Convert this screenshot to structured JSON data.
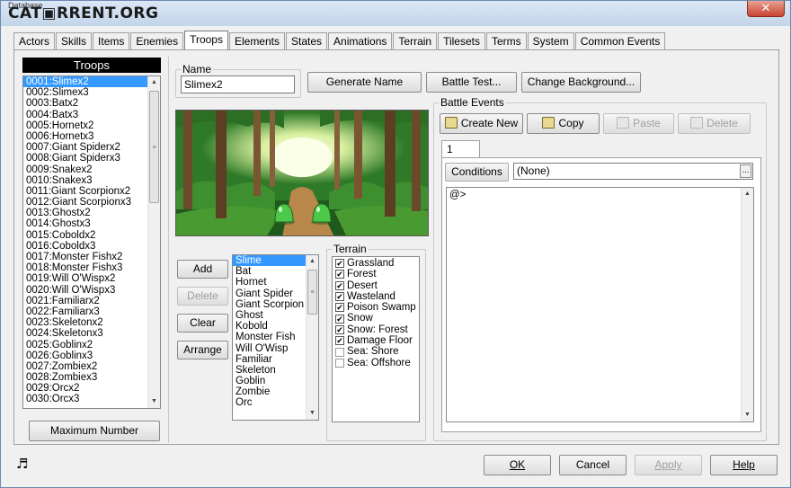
{
  "window": {
    "logo": "CAT▣RRENT.ORG",
    "title": "Database",
    "close_glyph": "✕"
  },
  "tabs": [
    {
      "label": "Actors"
    },
    {
      "label": "Skills"
    },
    {
      "label": "Items"
    },
    {
      "label": "Enemies"
    },
    {
      "label": "Troops"
    },
    {
      "label": "Elements"
    },
    {
      "label": "States"
    },
    {
      "label": "Animations"
    },
    {
      "label": "Terrain"
    },
    {
      "label": "Tilesets"
    },
    {
      "label": "Terms"
    },
    {
      "label": "System"
    },
    {
      "label": "Common Events"
    }
  ],
  "troops": {
    "header": "Troops",
    "selected_index": 0,
    "items": [
      "0001:Slimex2",
      "0002:Slimex3",
      "0003:Batx2",
      "0004:Batx3",
      "0005:Hornetx2",
      "0006:Hornetx3",
      "0007:Giant Spiderx2",
      "0008:Giant Spiderx3",
      "0009:Snakex2",
      "0010:Snakex3",
      "0011:Giant Scorpionx2",
      "0012:Giant Scorpionx3",
      "0013:Ghostx2",
      "0014:Ghostx3",
      "0015:Coboldx2",
      "0016:Coboldx3",
      "0017:Monster Fishx2",
      "0018:Monster Fishx3",
      "0019:Will O'Wispx2",
      "0020:Will O'Wispx3",
      "0021:Familiarx2",
      "0022:Familiarx3",
      "0023:Skeletonx2",
      "0024:Skeletonx3",
      "0025:Goblinx2",
      "0026:Goblinx3",
      "0027:Zombiex2",
      "0028:Zombiex3",
      "0029:Orcx2",
      "0030:Orcx3"
    ],
    "max_button": "Maximum Number"
  },
  "name_group": {
    "label": "Name",
    "value": "Slimex2"
  },
  "top_buttons": {
    "generate": "Generate Name",
    "battle_test": "Battle Test...",
    "change_bg": "Change Background..."
  },
  "enemy_buttons": {
    "add": "Add",
    "delete": "Delete",
    "clear": "Clear",
    "arrange": "Arrange"
  },
  "enemies": {
    "selected_index": 0,
    "items": [
      "Slime",
      "Bat",
      "Hornet",
      "Giant Spider",
      "Giant Scorpion",
      "Ghost",
      "Kobold",
      "Monster Fish",
      "Will O'Wisp",
      "Familiar",
      "Skeleton",
      "Goblin",
      "Zombie",
      "Orc"
    ]
  },
  "terrain": {
    "label": "Terrain",
    "check_glyph": "✔",
    "items": [
      {
        "label": "Grassland",
        "checked": true
      },
      {
        "label": "Forest",
        "checked": true
      },
      {
        "label": "Desert",
        "checked": true
      },
      {
        "label": "Wasteland",
        "checked": true
      },
      {
        "label": "Poison Swamp",
        "checked": true
      },
      {
        "label": "Snow",
        "checked": true
      },
      {
        "label": "Snow: Forest",
        "checked": true
      },
      {
        "label": "Damage Floor",
        "checked": true
      },
      {
        "label": "Sea: Shore",
        "checked": false
      },
      {
        "label": "Sea: Offshore",
        "checked": false
      }
    ]
  },
  "battle_events": {
    "label": "Battle Events",
    "create_new": "Create New",
    "copy": "Copy",
    "paste": "Paste",
    "delete": "Delete",
    "page_tab": "1",
    "conditions_label": "Conditions",
    "conditions_value": "(None)",
    "ellipsis": "...",
    "event_line": "@>"
  },
  "bottom": {
    "music_glyph": "♬",
    "ok": "OK",
    "cancel": "Cancel",
    "apply": "Apply",
    "help": "Help"
  },
  "colors": {
    "selection": "#3399ff",
    "slime": "#4ec84a"
  }
}
